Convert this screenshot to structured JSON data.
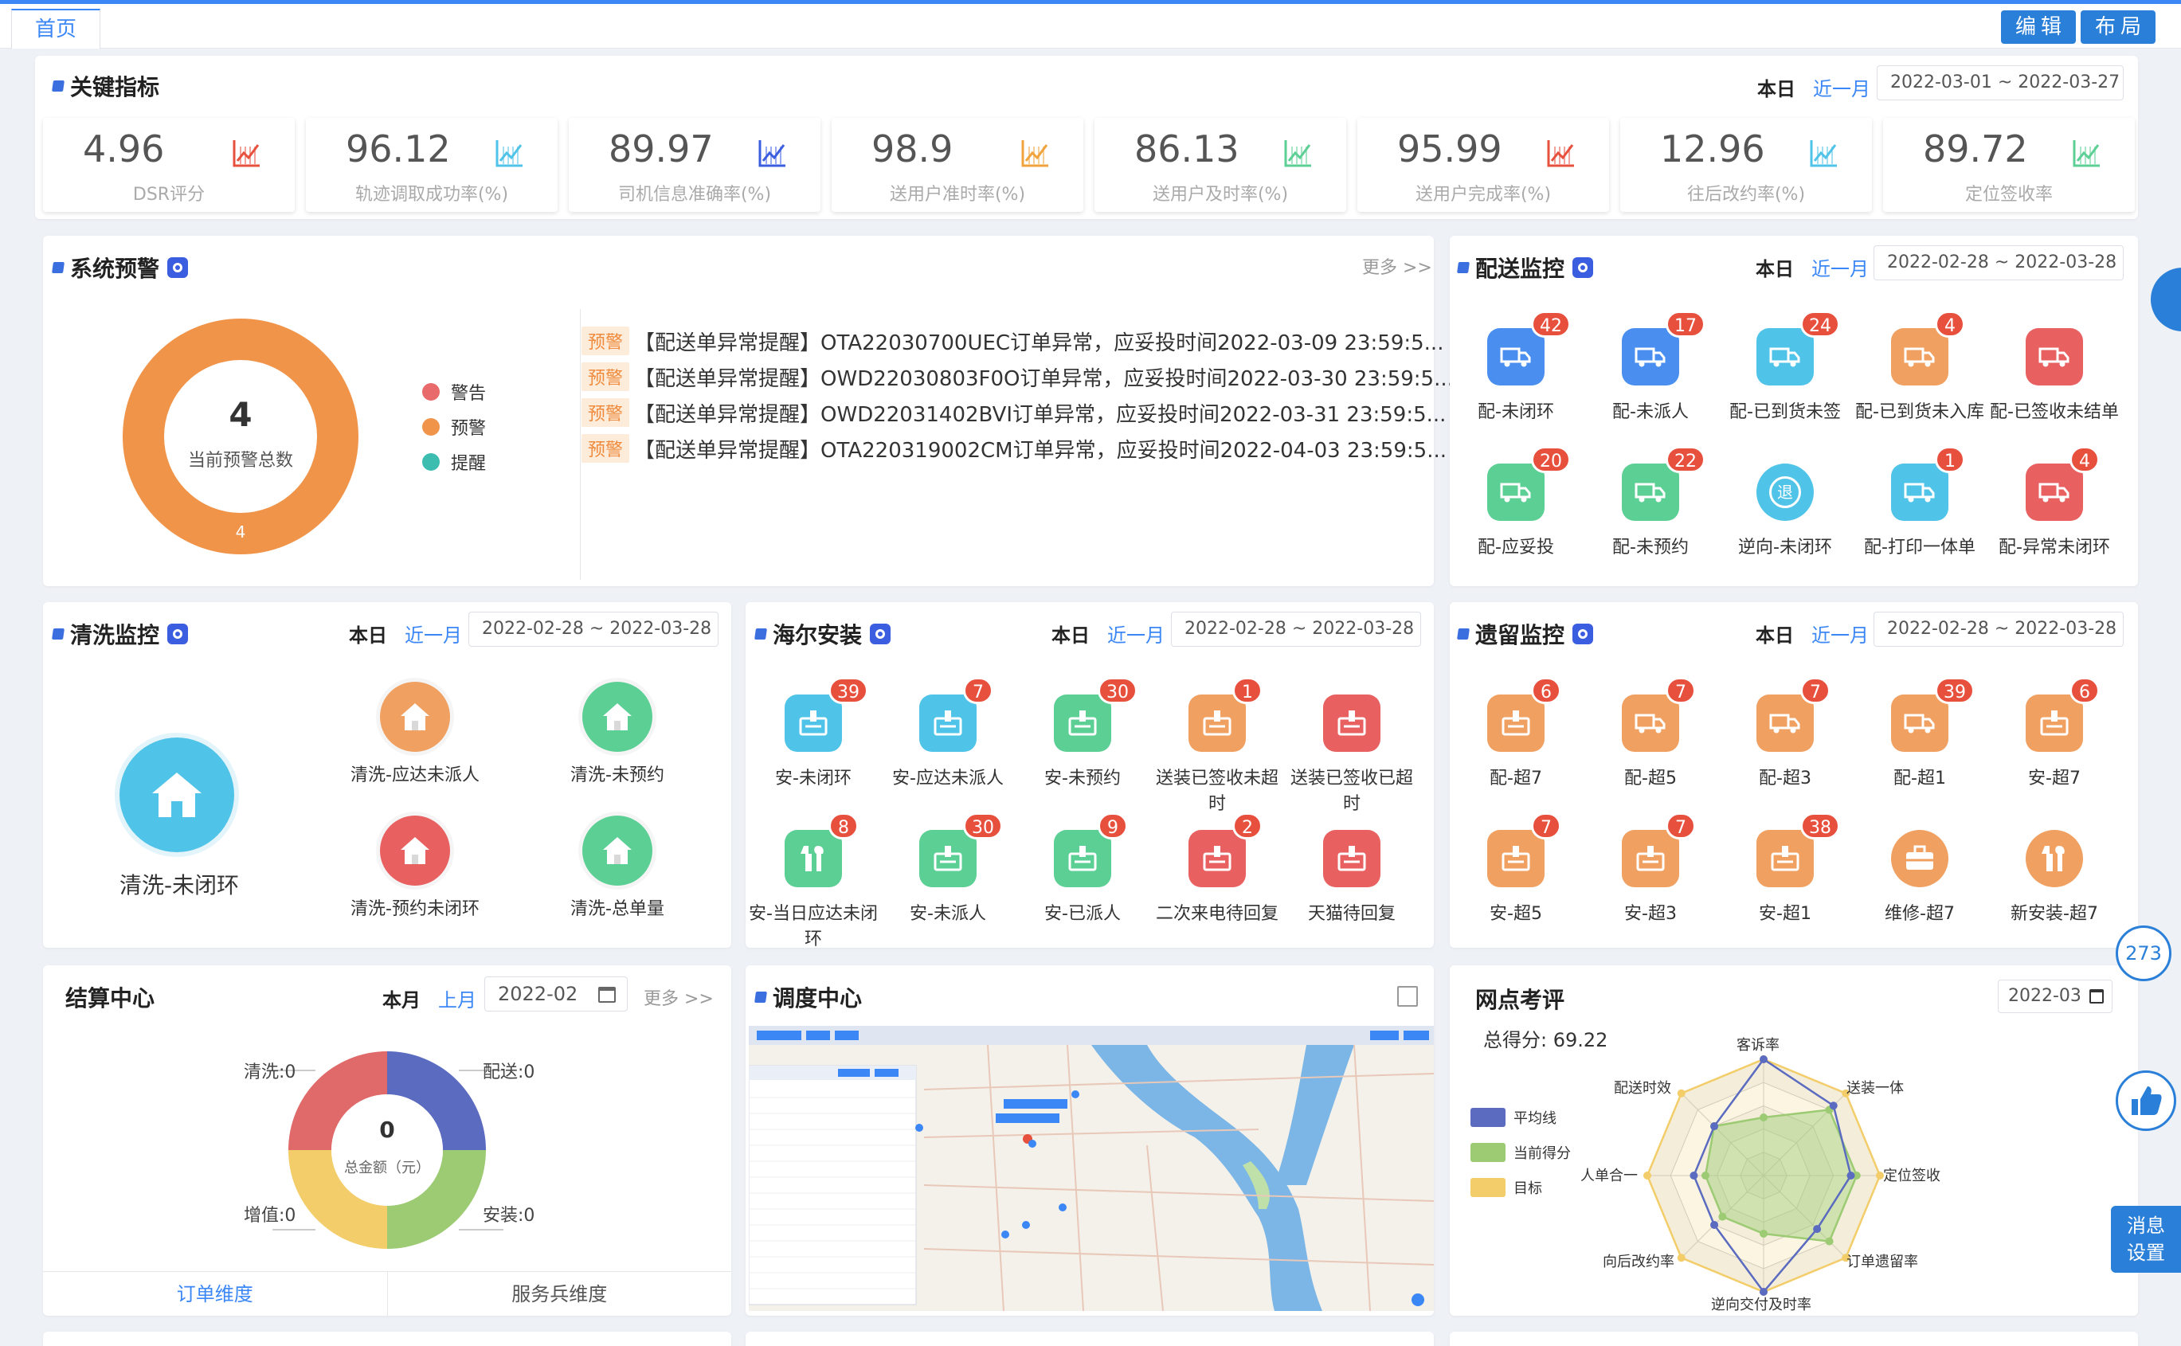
{
  "tabs": {
    "home": "首页"
  },
  "toolbar": {
    "edit": "编辑",
    "layout": "布局"
  },
  "kpi_section": {
    "title": "关键指标",
    "seg_today": "本日",
    "seg_month": "近一月",
    "date_range": "2022-03-01 ~ 2022-03-27",
    "items": [
      {
        "value": "4.96",
        "label": "DSR评分",
        "color": "#e8503e"
      },
      {
        "value": "96.12",
        "label": "轨迹调取成功率(%)",
        "color": "#4fc3e8"
      },
      {
        "value": "89.97",
        "label": "司机信息准确率(%)",
        "color": "#3b5de0"
      },
      {
        "value": "98.9",
        "label": "送用户准时率(%)",
        "color": "#f0a33c"
      },
      {
        "value": "86.13",
        "label": "送用户及时率(%)",
        "color": "#5ccf95"
      },
      {
        "value": "95.99",
        "label": "送用户完成率(%)",
        "color": "#e8503e"
      },
      {
        "value": "12.96",
        "label": "往后改约率(%)",
        "color": "#4fc3e8"
      },
      {
        "value": "89.72",
        "label": "定位签收率",
        "color": "#5ccf95"
      }
    ]
  },
  "warning": {
    "title": "系统预警",
    "more": "更多 >>",
    "total": "4",
    "total_label": "当前预警总数",
    "ring_label": "4",
    "legend": [
      {
        "label": "警告",
        "color": "#e86a6a"
      },
      {
        "label": "预警",
        "color": "#f0944a"
      },
      {
        "label": "提醒",
        "color": "#3cbdb0"
      }
    ],
    "alerts": [
      {
        "tag": "预警",
        "text": "【配送单异常提醒】OTA22030700UEC订单异常，应妥投时间2022-03-09 23:59:5..."
      },
      {
        "tag": "预警",
        "text": "【配送单异常提醒】OWD22030803F0O订单异常，应妥投时间2022-03-30 23:59:5..."
      },
      {
        "tag": "预警",
        "text": "【配送单异常提醒】OWD22031402BVI订单异常，应妥投时间2022-03-31 23:59:5..."
      },
      {
        "tag": "预警",
        "text": "【配送单异常提醒】OTA220319002CM订单异常，应妥投时间2022-04-03 23:59:5..."
      }
    ]
  },
  "delivery": {
    "title": "配送监控",
    "seg_today": "本日",
    "seg_month": "近一月",
    "date_range": "2022-02-28 ~ 2022-03-28",
    "tiles": [
      {
        "label": "配-未闭环",
        "count": "42",
        "color": "#4a8ff0"
      },
      {
        "label": "配-未派人",
        "count": "17",
        "color": "#4a8ff0"
      },
      {
        "label": "配-已到货未签",
        "count": "24",
        "color": "#4fc3e8"
      },
      {
        "label": "配-已到货未入库",
        "count": "4",
        "color": "#f0a060"
      },
      {
        "label": "配-已签收未结单",
        "count": "",
        "color": "#e86060"
      },
      {
        "label": "配-应妥投",
        "count": "20",
        "color": "#5ccf95"
      },
      {
        "label": "配-未预约",
        "count": "22",
        "color": "#5ccf95"
      },
      {
        "label": "逆向-未闭环",
        "count": "",
        "color": "#4fc3e8"
      },
      {
        "label": "配-打印一体单",
        "count": "1",
        "color": "#4fc3e8"
      },
      {
        "label": "配-异常未闭环",
        "count": "4",
        "color": "#e86060"
      }
    ],
    "reverse_glyph": "退"
  },
  "cleaning": {
    "title": "清洗监控",
    "seg_today": "本日",
    "seg_month": "近一月",
    "date_range": "2022-02-28 ~ 2022-03-28",
    "big_label": "清洗-未闭环",
    "tiles": [
      {
        "label": "清洗-应达未派人",
        "color": "#f0a060"
      },
      {
        "label": "清洗-未预约",
        "color": "#5ccf95"
      },
      {
        "label": "清洗-预约未闭环",
        "color": "#e86060"
      },
      {
        "label": "清洗-总单量",
        "color": "#5ccf95"
      }
    ]
  },
  "haier": {
    "title": "海尔安装",
    "seg_today": "本日",
    "seg_month": "近一月",
    "date_range": "2022-02-28 ~ 2022-03-28",
    "tiles": [
      {
        "label": "安-未闭环",
        "count": "39",
        "color": "#4fc3e8"
      },
      {
        "label": "安-应达未派人",
        "count": "7",
        "color": "#4fc3e8"
      },
      {
        "label": "安-未预约",
        "count": "30",
        "color": "#5ccf95"
      },
      {
        "label": "送装已签收未超时",
        "count": "1",
        "color": "#f0a060"
      },
      {
        "label": "送装已签收已超时",
        "count": "",
        "color": "#e86060"
      },
      {
        "label": "安-当日应达未闭环",
        "count": "8",
        "color": "#5ccf95"
      },
      {
        "label": "安-未派人",
        "count": "30",
        "color": "#5ccf95"
      },
      {
        "label": "安-已派人",
        "count": "9",
        "color": "#5ccf95"
      },
      {
        "label": "二次来电待回复",
        "count": "2",
        "color": "#e86060"
      },
      {
        "label": "天猫待回复",
        "count": "",
        "color": "#e86060"
      }
    ]
  },
  "leftover": {
    "title": "遗留监控",
    "seg_today": "本日",
    "seg_month": "近一月",
    "date_range": "2022-02-28 ~ 2022-03-28",
    "tiles": [
      {
        "label": "配-超7",
        "count": "6",
        "color": "#f0a060"
      },
      {
        "label": "配-超5",
        "count": "7",
        "color": "#f0a060"
      },
      {
        "label": "配-超3",
        "count": "7",
        "color": "#f0a060"
      },
      {
        "label": "配-超1",
        "count": "39",
        "color": "#f0a060"
      },
      {
        "label": "安-超7",
        "count": "6",
        "color": "#f0a060"
      },
      {
        "label": "安-超5",
        "count": "7",
        "color": "#f0a060"
      },
      {
        "label": "安-超3",
        "count": "7",
        "color": "#f0a060"
      },
      {
        "label": "安-超1",
        "count": "38",
        "color": "#f0a060"
      },
      {
        "label": "维修-超7",
        "count": "",
        "color": "#f0a060"
      },
      {
        "label": "新安装-超7",
        "count": "",
        "color": "#f0a060"
      }
    ]
  },
  "settlement": {
    "title": "结算中心",
    "seg_month": "本月",
    "seg_last": "上月",
    "month": "2022-02",
    "more": "更多 >>",
    "total": "0",
    "total_label": "总金额（元）",
    "slices": [
      {
        "label": "清洗:0",
        "color": "#e06a6a"
      },
      {
        "label": "配送:0",
        "color": "#5a6bc0"
      },
      {
        "label": "安装:0",
        "color": "#9ccb74"
      },
      {
        "label": "增值:0",
        "color": "#f2cd6a"
      }
    ],
    "tab_order": "订单维度",
    "tab_service": "服务兵维度"
  },
  "dispatch": {
    "title": "调度中心"
  },
  "review": {
    "title": "网点考评",
    "month": "2022-03",
    "total": "总得分: 69.22",
    "legend": [
      {
        "label": "平均线",
        "color": "#5a6bc0"
      },
      {
        "label": "当前得分",
        "color": "#9ccb74"
      },
      {
        "label": "目标",
        "color": "#f2cd6a"
      }
    ],
    "axes": [
      "客诉率",
      "送装一体",
      "定位签收",
      "订单遗留率",
      "逆向交付及时率",
      "向后改约率",
      "人单合一",
      "配送时效"
    ]
  },
  "side": {
    "count": "273",
    "msg1": "消息",
    "msg2": "设置"
  }
}
